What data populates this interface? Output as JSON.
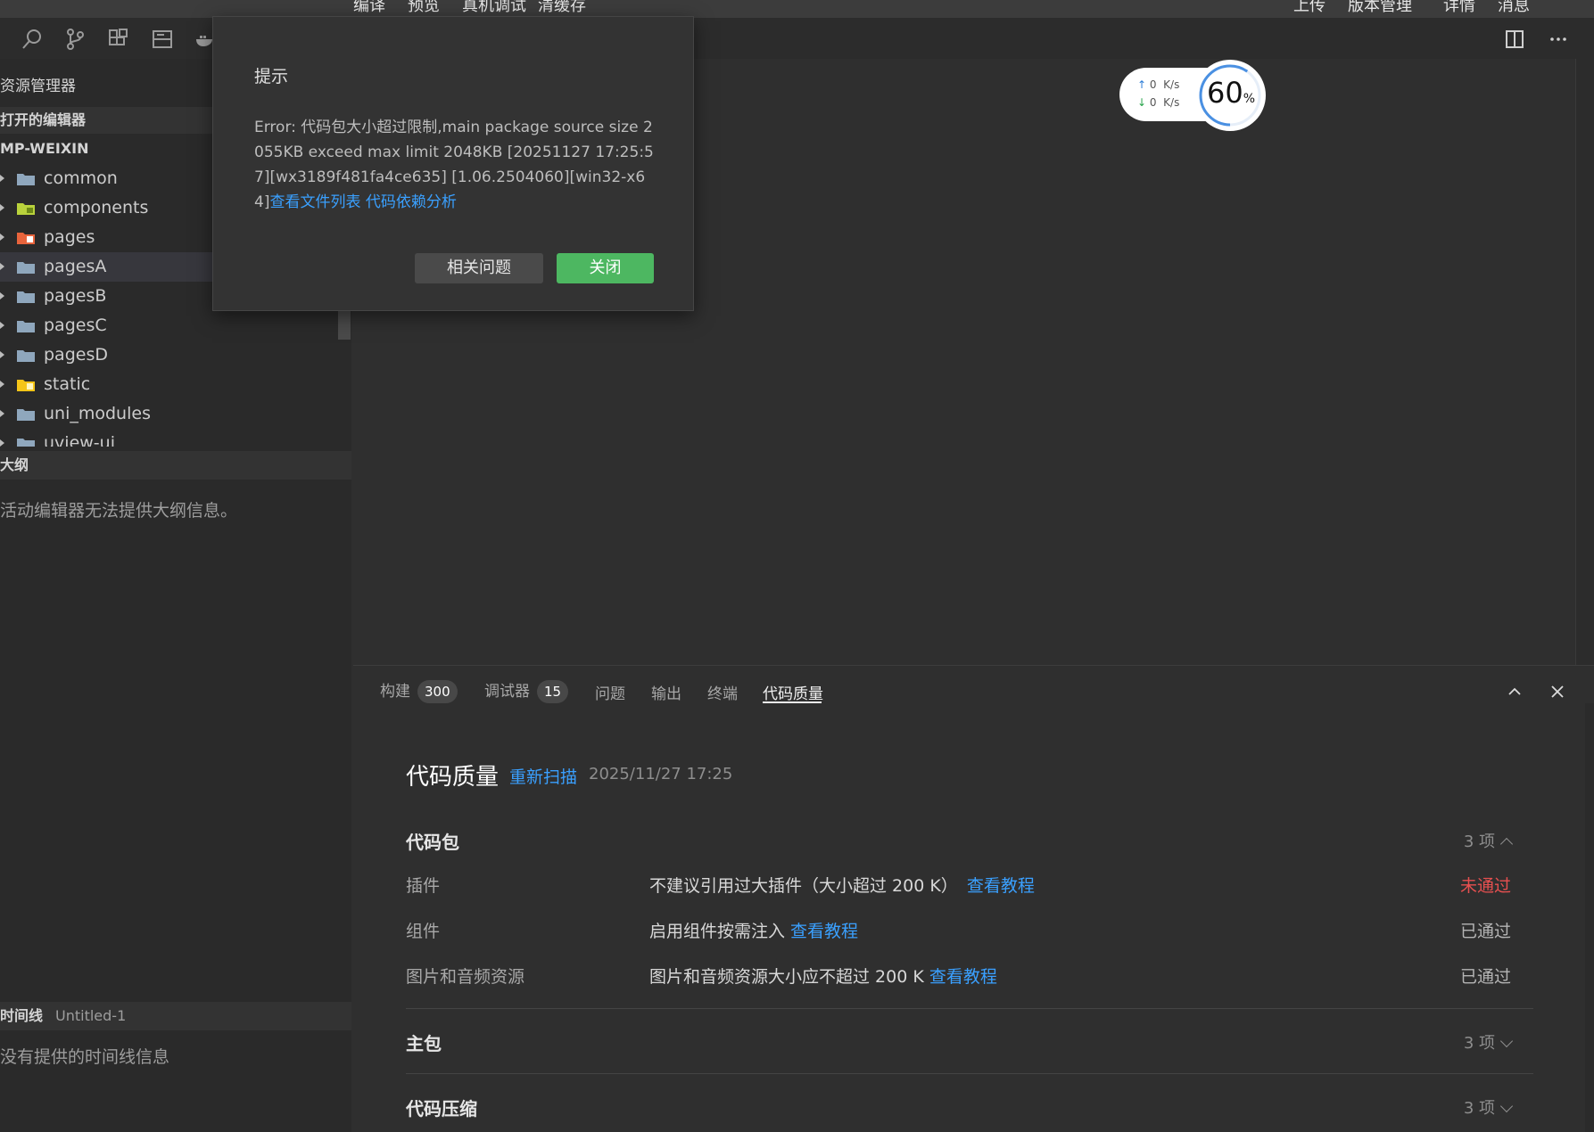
{
  "menu": {
    "items_left": [
      "编译",
      "预览",
      "真机调试",
      "清缓存"
    ],
    "items_right": [
      "上传",
      "版本管理",
      "详情",
      "消息"
    ]
  },
  "toolbar_icons": [
    "search-icon",
    "source-control-icon",
    "extensions-icon",
    "layout-icon",
    "docker-icon"
  ],
  "sidebar": {
    "title": "资源管理器",
    "open_editors": "打开的编辑器",
    "project": "MP-WEIXIN",
    "tree": [
      {
        "label": "common",
        "icon": "folder-icon"
      },
      {
        "label": "components",
        "icon": "folder-components-icon"
      },
      {
        "label": "pages",
        "icon": "folder-pages-icon"
      },
      {
        "label": "pagesA",
        "icon": "folder-icon"
      },
      {
        "label": "pagesB",
        "icon": "folder-icon"
      },
      {
        "label": "pagesC",
        "icon": "folder-icon"
      },
      {
        "label": "pagesD",
        "icon": "folder-icon"
      },
      {
        "label": "static",
        "icon": "folder-static-icon"
      },
      {
        "label": "uni_modules",
        "icon": "folder-icon"
      },
      {
        "label": "uview-ui",
        "icon": "folder-icon"
      }
    ],
    "outline_title": "大纲",
    "outline_empty": "活动编辑器无法提供大纲信息。",
    "timeline_title": "时间线",
    "timeline_file": "Untitled-1",
    "timeline_empty": "没有提供的时间线信息"
  },
  "network_widget": {
    "up": "0",
    "down": "0",
    "unit": "K/s",
    "percent": "60",
    "percent_unit": "%"
  },
  "dialog": {
    "title": "提示",
    "message": "Error: 代码包大小超过限制,main package source size 2055KB exceed max limit 2048KB [20251127 17:25:57][wx3189f481fa4ce635] [1.06.2504060][win32-x64]",
    "link_files": "查看文件列表",
    "link_deps": "代码依赖分析",
    "btn_related": "相关问题",
    "btn_close": "关闭"
  },
  "panel": {
    "tabs": [
      {
        "label": "构建",
        "badge": "300"
      },
      {
        "label": "调试器",
        "badge": "15"
      },
      {
        "label": "问题",
        "badge": ""
      },
      {
        "label": "输出",
        "badge": ""
      },
      {
        "label": "终端",
        "badge": ""
      },
      {
        "label": "代码质量",
        "badge": ""
      }
    ],
    "active_tab": "代码质量"
  },
  "code_quality": {
    "title": "代码质量",
    "rescan": "重新扫描",
    "time": "2025/11/27 17:25",
    "groups": [
      {
        "name": "代码包",
        "count": "3 项",
        "expanded": true,
        "rows": [
          {
            "name": "插件",
            "desc": "不建议引用过大插件（大小超过 200 K）",
            "link": "查看教程",
            "status": "未通过"
          },
          {
            "name": "组件",
            "desc": "启用组件按需注入",
            "link": "查看教程",
            "status": "已通过"
          },
          {
            "name": "图片和音频资源",
            "desc": "图片和音频资源大小应不超过 200 K",
            "link": "查看教程",
            "status": "已通过"
          }
        ]
      },
      {
        "name": "主包",
        "count": "3 项",
        "expanded": false
      },
      {
        "name": "代码压缩",
        "count": "3 项",
        "expanded": false
      }
    ]
  },
  "colors": {
    "accent_link": "#3aa0ff",
    "fail": "#e85050",
    "primary_button": "#4db761"
  }
}
